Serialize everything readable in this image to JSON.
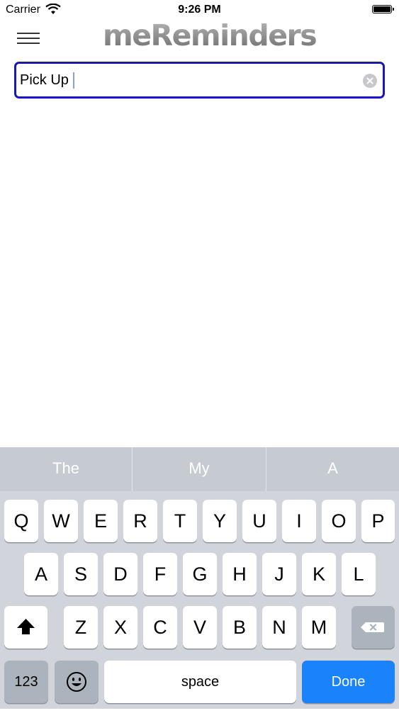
{
  "status_bar": {
    "carrier": "Carrier",
    "time": "9:26 PM"
  },
  "header": {
    "logo_text": "meReminders"
  },
  "search": {
    "value": "Pick Up"
  },
  "keyboard": {
    "suggestions": [
      "The",
      "My",
      "A"
    ],
    "row1": [
      "Q",
      "W",
      "E",
      "R",
      "T",
      "Y",
      "U",
      "I",
      "O",
      "P"
    ],
    "row2": [
      "A",
      "S",
      "D",
      "F",
      "G",
      "H",
      "J",
      "K",
      "L"
    ],
    "row3": [
      "Z",
      "X",
      "C",
      "V",
      "B",
      "N",
      "M"
    ],
    "numbers_label": "123",
    "space_label": "space",
    "done_label": "Done"
  },
  "colors": {
    "field_border": "#1a16b8",
    "done_key": "#1a82fb",
    "keyboard_bg": "#d1d5db"
  }
}
